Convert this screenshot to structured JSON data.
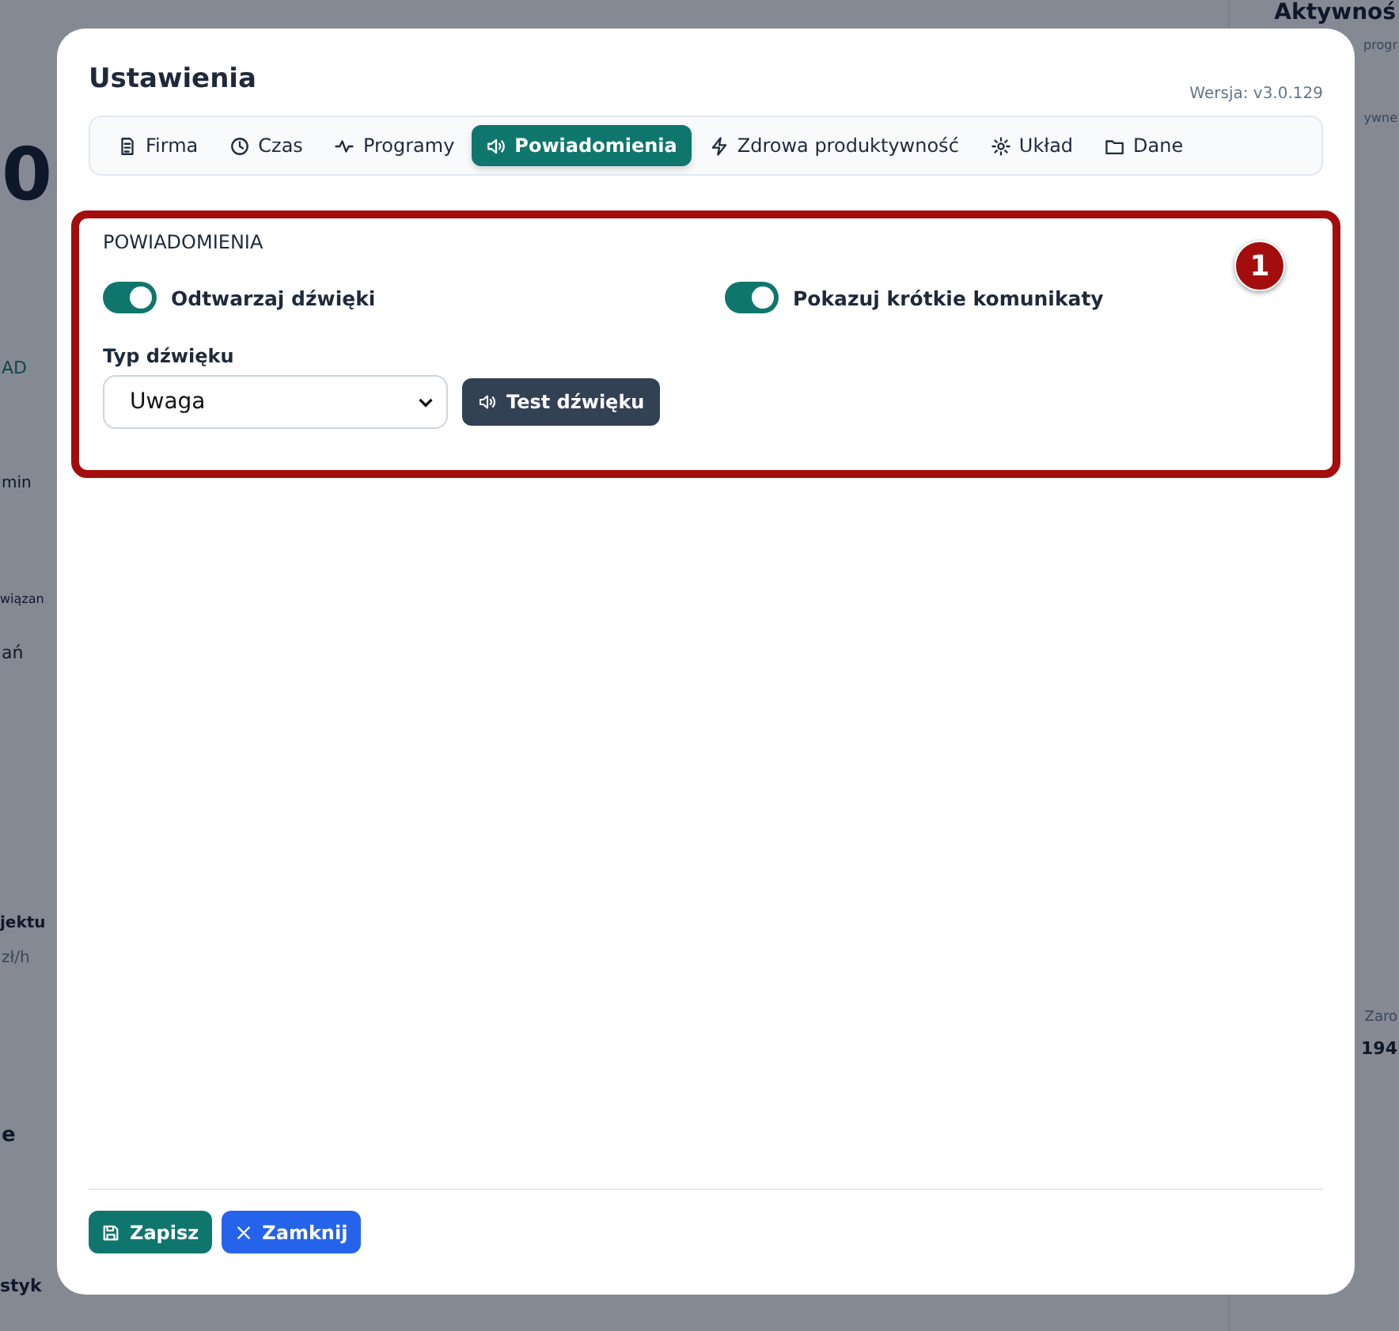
{
  "background": {
    "top_right_heading": "Aktywnoś",
    "top_right_line": "progr",
    "right_line": "ywne",
    "big_number": "0",
    "left_label": "AD",
    "left_button": "min",
    "left_section": "wiązan",
    "left_button_2": "ań",
    "left_heading": "jektu",
    "left_rate": "zł/h",
    "right_label": "Zaro",
    "right_value": "194",
    "left_row": "e",
    "bottom_heading": "styk"
  },
  "dialog": {
    "title": "Ustawienia",
    "version": "Wersja: v3.0.129",
    "tabs": [
      {
        "label": "Firma",
        "selected": false
      },
      {
        "label": "Czas",
        "selected": false
      },
      {
        "label": "Programy",
        "selected": false
      },
      {
        "label": "Powiadomienia",
        "selected": true
      },
      {
        "label": "Zdrowa produktywność",
        "selected": false
      },
      {
        "label": "Układ",
        "selected": false
      },
      {
        "label": "Dane",
        "selected": false
      }
    ],
    "section": {
      "heading": "POWIADOMIENIA",
      "annotation": "1",
      "toggles": [
        {
          "label": "Odtwarzaj dźwięki",
          "on": true
        },
        {
          "label": "Pokazuj krótkie komunikaty",
          "on": true
        }
      ],
      "sound_type": {
        "label": "Typ dźwięku",
        "value": "Uwaga"
      },
      "test_button": "Test dźwięku"
    },
    "buttons": [
      {
        "label": "Zapisz",
        "kind": "save"
      },
      {
        "label": "Zamknij",
        "kind": "close"
      }
    ]
  }
}
